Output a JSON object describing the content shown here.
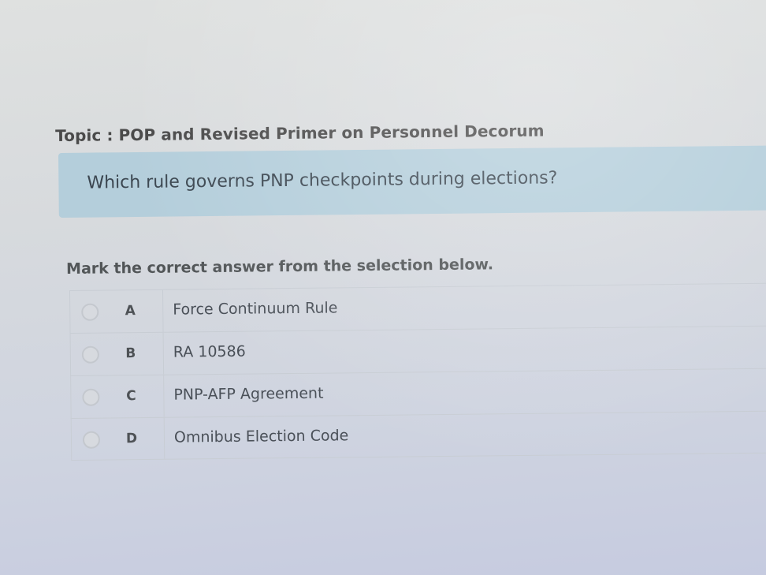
{
  "topic": "Topic : POP and Revised Primer on Personnel Decorum",
  "question": "Which rule governs PNP checkpoints during elections?",
  "instruction": "Mark the correct answer from the selection below.",
  "options": [
    {
      "letter": "A",
      "text": "Force Continuum Rule"
    },
    {
      "letter": "B",
      "text": "RA 10586"
    },
    {
      "letter": "C",
      "text": "PNP-AFP Agreement"
    },
    {
      "letter": "D",
      "text": "Omnibus Election Code"
    }
  ],
  "colors": {
    "question_box": "#b4cedb",
    "background": "#d7dadd"
  }
}
